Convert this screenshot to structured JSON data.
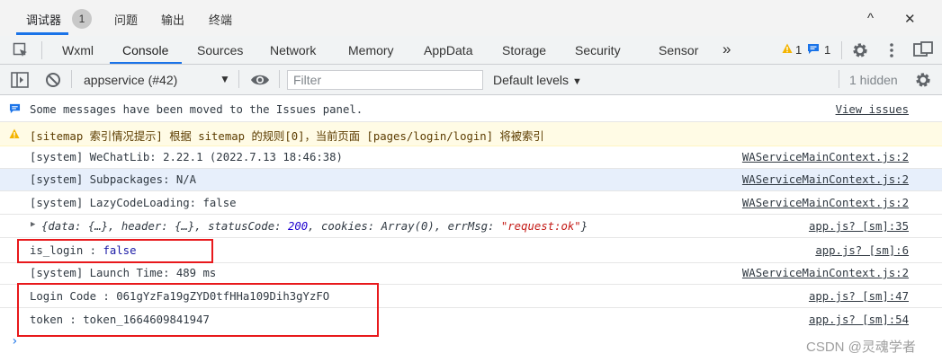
{
  "panel_tabs": {
    "debugger": "调试器",
    "badge": "1",
    "issues": "问题",
    "output": "输出",
    "terminal": "终端"
  },
  "window": {
    "collapse": "^",
    "close": "✕"
  },
  "devtools_tabs": {
    "items": [
      "Wxml",
      "Console",
      "Sources",
      "Network",
      "Memory",
      "AppData",
      "Storage",
      "Security",
      "Sensor"
    ],
    "active": "Console",
    "more": "»",
    "warn_count": "1",
    "info_count": "1"
  },
  "toolbar": {
    "context": "appservice (#42)",
    "filter_placeholder": "Filter",
    "levels": "Default levels",
    "hidden": "1 hidden"
  },
  "messages": [
    {
      "text": "Some messages have been moved to the Issues panel.",
      "source": "View issues"
    },
    {
      "text": "[sitemap 索引情况提示] 根据 sitemap 的规则[0]，当前页面 [pages/login/login] 将被索引",
      "source": ""
    },
    {
      "text": "[system] WeChatLib: 2.22.1 (2022.7.13 18:46:38)",
      "source": "WAServiceMainContext.js:2"
    },
    {
      "text": "[system] Subpackages: N/A",
      "source": "WAServiceMainContext.js:2"
    },
    {
      "text": "[system] LazyCodeLoading: false",
      "source": "WAServiceMainContext.js:2"
    },
    {
      "text_prefix": "{data: {…}, header: {…}, statusCode: ",
      "status_code": "200",
      "text_mid": ", cookies: Array(0), errMsg: ",
      "err_msg": "\"request:ok\"",
      "text_suffix": "}",
      "source": "app.js? [sm]:35"
    },
    {
      "label": "is_login :",
      "value": "false",
      "source": "app.js? [sm]:6"
    },
    {
      "text": "[system] Launch Time: 489 ms",
      "source": "WAServiceMainContext.js:2"
    },
    {
      "text": "Login Code : 061gYzFa19gZYD0tfHHa109Dih3gYzFO",
      "source": "app.js? [sm]:47"
    },
    {
      "text": "token : token_1664609841947",
      "source": "app.js? [sm]:54"
    }
  ],
  "prompt": "›",
  "watermark": "CSDN @灵魂学者",
  "colors": {
    "accent": "#1a73e8",
    "highlight_box": "#e8191c",
    "warning_bg": "#fffbe5"
  }
}
